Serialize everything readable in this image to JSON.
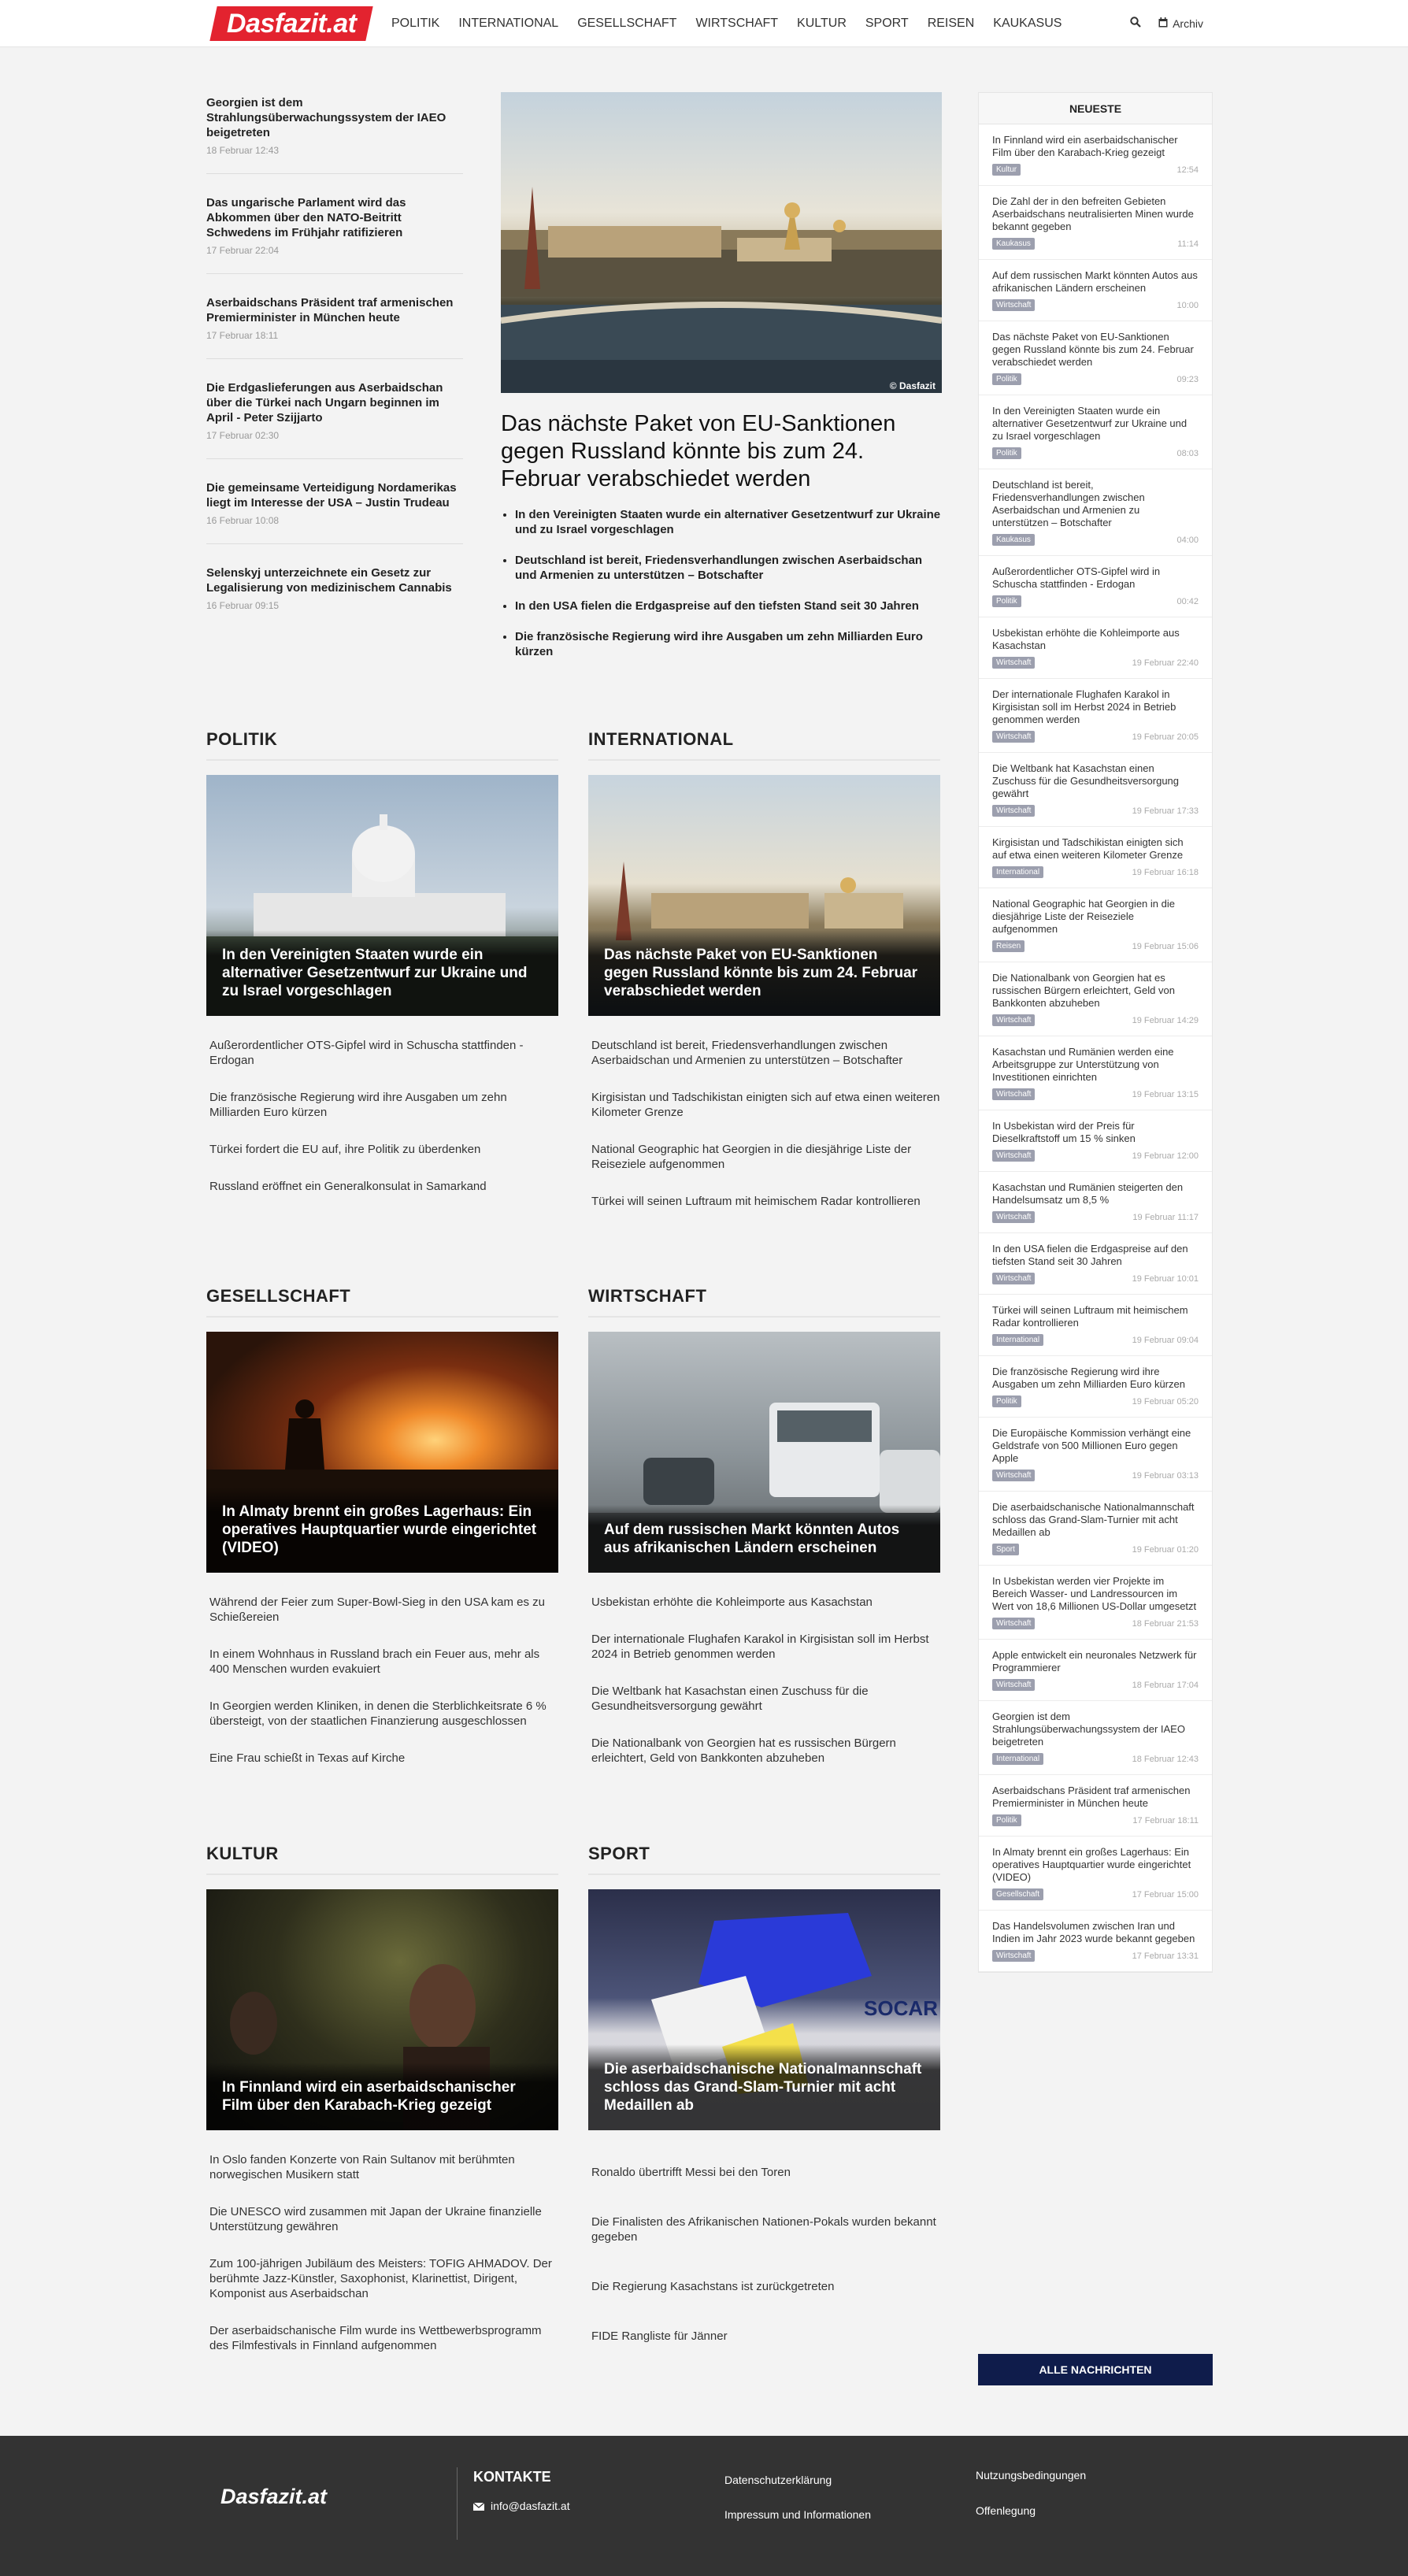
{
  "site": {
    "logo": "Dasfazit.at"
  },
  "nav": [
    "POLITIK",
    "INTERNATIONAL",
    "GESELLSCHAFT",
    "WIRTSCHAFT",
    "KULTUR",
    "SPORT",
    "REISEN",
    "KAUKASUS"
  ],
  "header": {
    "archive": "Archiv"
  },
  "toplist": [
    {
      "title": "Georgien ist dem Strahlungsüberwachungssystem der IAEO beigetreten",
      "date": "18 Februar 12:43"
    },
    {
      "title": "Das ungarische Parlament wird das Abkommen über den NATO-Beitritt Schwedens im Frühjahr ratifizieren",
      "date": "17 Februar 22:04"
    },
    {
      "title": "Aserbaidschans Präsident traf armenischen Premierminister in München heute",
      "date": "17 Februar 18:11"
    },
    {
      "title": "Die Erdgaslieferungen aus Aserbaidschan über die Türkei nach Ungarn beginnen im April - Peter Szijjarto",
      "date": "17 Februar 02:30"
    },
    {
      "title": "Die gemeinsame Verteidigung Nordamerikas liegt im Interesse der USA – Justin Trudeau",
      "date": "16 Februar 10:08"
    },
    {
      "title": "Selenskyj unterzeichnete ein Gesetz zur Legalisierung von medizinischem Cannabis",
      "date": "16 Februar 09:15"
    }
  ],
  "featured": {
    "title": "Das nächste Paket von EU-Sanktionen gegen Russland könnte bis zum 24. Februar verabschiedet werden",
    "credit": "© Dasfazit",
    "bullets": [
      "In den Vereinigten Staaten wurde ein alternativer Gesetzentwurf zur Ukraine und zu Israel vorgeschlagen",
      "Deutschland ist bereit, Friedensverhandlungen zwischen Aserbaidschan und Armenien zu unterstützen – Botschafter",
      "In den USA fielen die Erdgaspreise auf den tiefsten Stand seit 30 Jahren",
      "Die französische Regierung wird ihre Ausgaben um zehn Milliarden Euro kürzen"
    ]
  },
  "categories": [
    {
      "name": "POLITIK",
      "headline": "In den Vereinigten Staaten wurde ein alternativer Gesetzentwurf zur Ukraine und zu Israel vorgeschlagen",
      "items": [
        "Außerordentlicher OTS-Gipfel wird in Schuscha stattfinden - Erdogan",
        "Die französische Regierung wird ihre Ausgaben um zehn Milliarden Euro kürzen",
        "Türkei fordert die EU auf, ihre Politik zu überdenken",
        "Russland eröffnet ein Generalkonsulat in Samarkand"
      ]
    },
    {
      "name": "INTERNATIONAL",
      "headline": "Das nächste Paket von EU-Sanktionen gegen Russland könnte bis zum 24. Februar verabschiedet werden",
      "items": [
        "Deutschland ist bereit, Friedensverhandlungen zwischen Aserbaidschan und Armenien zu unterstützen – Botschafter",
        "Kirgisistan und Tadschikistan einigten sich auf etwa einen weiteren Kilometer Grenze",
        "National Geographic hat Georgien in die diesjährige Liste der Reiseziele aufgenommen",
        "Türkei will seinen Luftraum mit heimischem Radar kontrollieren"
      ]
    },
    {
      "name": "GESELLSCHAFT",
      "headline": "In Almaty brennt ein großes Lagerhaus: Ein operatives Hauptquartier wurde eingerichtet (VIDEO)",
      "items": [
        "Während der Feier zum Super-Bowl-Sieg in den USA kam es zu Schießereien",
        "In einem Wohnhaus in Russland brach ein Feuer aus, mehr als 400 Menschen wurden evakuiert",
        "In Georgien werden Kliniken, in denen die Sterblichkeitsrate 6 % übersteigt, von der staatlichen Finanzierung ausgeschlossen",
        "Eine Frau schießt in Texas auf Kirche"
      ]
    },
    {
      "name": "WIRTSCHAFT",
      "headline": "Auf dem russischen Markt könnten Autos aus afrikanischen Ländern erscheinen",
      "items": [
        "Usbekistan erhöhte die Kohleimporte aus Kasachstan",
        "Der internationale Flughafen Karakol in Kirgisistan soll im Herbst 2024 in Betrieb genommen werden",
        "Die Weltbank hat Kasachstan einen Zuschuss für die Gesundheitsversorgung gewährt",
        "Die Nationalbank von Georgien hat es russischen Bürgern erleichtert, Geld von Bankkonten abzuheben"
      ]
    },
    {
      "name": "KULTUR",
      "headline": "In Finnland wird ein aserbaidschanischer Film über den Karabach-Krieg gezeigt",
      "items": [
        "In Oslo fanden Konzerte von Rain Sultanov mit berühmten norwegischen Musikern statt",
        "Die UNESCO wird zusammen mit Japan der Ukraine finanzielle Unterstützung gewähren",
        "Zum 100-jährigen Jubiläum des Meisters: TOFIG AHMADOV. Der berühmte Jazz-Künstler, Saxophonist, Klarinettist, Dirigent, Komponist aus Aserbaidschan",
        "Der aserbaidschanische Film wurde ins Wettbewerbsprogramm des Filmfestivals in Finnland aufgenommen"
      ]
    },
    {
      "name": "SPORT",
      "headline": "Die aserbaidschanische Nationalmannschaft schloss das Grand-Slam-Turnier mit acht Medaillen ab",
      "items": [
        "Ronaldo übertrifft Messi bei den Toren",
        "Die Finalisten des Afrikanischen Nationen-Pokals wurden bekannt gegeben",
        "Die Regierung Kasachstans ist zurückgetreten",
        "FIDE Rangliste für Jänner"
      ]
    }
  ],
  "sidebar": {
    "title": "NEUESTE",
    "button": "ALLE NACHRICHTEN",
    "items": [
      {
        "title": "In Finnland wird ein aserbaidschanischer Film über den Karabach-Krieg gezeigt",
        "cat": "Kultur",
        "date": "12:54"
      },
      {
        "title": "Die Zahl der in den befreiten Gebieten Aserbaidschans neutralisierten Minen wurde bekannt gegeben",
        "cat": "Kaukasus",
        "date": "11:14"
      },
      {
        "title": "Auf dem russischen Markt könnten Autos aus afrikanischen Ländern erscheinen",
        "cat": "Wirtschaft",
        "date": "10:00"
      },
      {
        "title": "Das nächste Paket von EU-Sanktionen gegen Russland könnte bis zum 24. Februar verabschiedet werden",
        "cat": "Politik",
        "date": "09:23"
      },
      {
        "title": "In den Vereinigten Staaten wurde ein alternativer Gesetzentwurf zur Ukraine und zu Israel vorgeschlagen",
        "cat": "Politik",
        "date": "08:03"
      },
      {
        "title": "Deutschland ist bereit, Friedensverhandlungen zwischen Aserbaidschan und Armenien zu unterstützen – Botschafter",
        "cat": "Kaukasus",
        "date": "04:00"
      },
      {
        "title": "Außerordentlicher OTS-Gipfel wird in Schuscha stattfinden - Erdogan",
        "cat": "Politik",
        "date": "00:42"
      },
      {
        "title": "Usbekistan erhöhte die Kohleimporte aus Kasachstan",
        "cat": "Wirtschaft",
        "date": "19 Februar 22:40"
      },
      {
        "title": "Der internationale Flughafen Karakol in Kirgisistan soll im Herbst 2024 in Betrieb genommen werden",
        "cat": "Wirtschaft",
        "date": "19 Februar 20:05"
      },
      {
        "title": "Die Weltbank hat Kasachstan einen Zuschuss für die Gesundheitsversorgung gewährt",
        "cat": "Wirtschaft",
        "date": "19 Februar 17:33"
      },
      {
        "title": "Kirgisistan und Tadschikistan einigten sich auf etwa einen weiteren Kilometer Grenze",
        "cat": "International",
        "date": "19 Februar 16:18"
      },
      {
        "title": "National Geographic hat Georgien in die diesjährige Liste der Reiseziele aufgenommen",
        "cat": "Reisen",
        "date": "19 Februar 15:06"
      },
      {
        "title": "Die Nationalbank von Georgien hat es russischen Bürgern erleichtert, Geld von Bankkonten abzuheben",
        "cat": "Wirtschaft",
        "date": "19 Februar 14:29"
      },
      {
        "title": "Kasachstan und Rumänien werden eine Arbeitsgruppe zur Unterstützung von Investitionen einrichten",
        "cat": "Wirtschaft",
        "date": "19 Februar 13:15"
      },
      {
        "title": "In Usbekistan wird der Preis für Dieselkraftstoff um 15 % sinken",
        "cat": "Wirtschaft",
        "date": "19 Februar 12:00"
      },
      {
        "title": "Kasachstan und Rumänien steigerten den Handelsumsatz um 8,5 %",
        "cat": "Wirtschaft",
        "date": "19 Februar 11:17"
      },
      {
        "title": "In den USA fielen die Erdgaspreise auf den tiefsten Stand seit 30 Jahren",
        "cat": "Wirtschaft",
        "date": "19 Februar 10:01"
      },
      {
        "title": "Türkei will seinen Luftraum mit heimischem Radar kontrollieren",
        "cat": "International",
        "date": "19 Februar 09:04"
      },
      {
        "title": "Die französische Regierung wird ihre Ausgaben um zehn Milliarden Euro kürzen",
        "cat": "Politik",
        "date": "19 Februar 05:20"
      },
      {
        "title": "Die Europäische Kommission verhängt eine Geldstrafe von 500 Millionen Euro gegen Apple",
        "cat": "Wirtschaft",
        "date": "19 Februar 03:13"
      },
      {
        "title": "Die aserbaidschanische Nationalmannschaft schloss das Grand-Slam-Turnier mit acht Medaillen ab",
        "cat": "Sport",
        "date": "19 Februar 01:20"
      },
      {
        "title": "In Usbekistan werden vier Projekte im Bereich Wasser- und Landressourcen im Wert von 18,6 Millionen US-Dollar umgesetzt",
        "cat": "Wirtschaft",
        "date": "18 Februar 21:53"
      },
      {
        "title": "Apple entwickelt ein neuronales Netzwerk für Programmierer",
        "cat": "Wirtschaft",
        "date": "18 Februar 17:04"
      },
      {
        "title": "Georgien ist dem Strahlungsüberwachungssystem der IAEO beigetreten",
        "cat": "International",
        "date": "18 Februar 12:43"
      },
      {
        "title": "Aserbaidschans Präsident traf armenischen Premierminister in München heute",
        "cat": "Politik",
        "date": "17 Februar 18:11"
      },
      {
        "title": "In Almaty brennt ein großes Lagerhaus: Ein operatives Hauptquartier wurde eingerichtet (VIDEO)",
        "cat": "Gesellschaft",
        "date": "17 Februar 15:00"
      },
      {
        "title": "Das Handelsvolumen zwischen Iran und Indien im Jahr 2023 wurde bekannt gegeben",
        "cat": "Wirtschaft",
        "date": "17 Februar 13:31"
      }
    ]
  },
  "footer": {
    "logo": "Dasfazit.at",
    "contacts_title": "KONTAKTE",
    "email": "info@dasfazit.at",
    "links": [
      "Datenschutzerklärung",
      "Impressum und Informationen",
      "Nutzungsbedingungen",
      "Offenlegung"
    ]
  }
}
